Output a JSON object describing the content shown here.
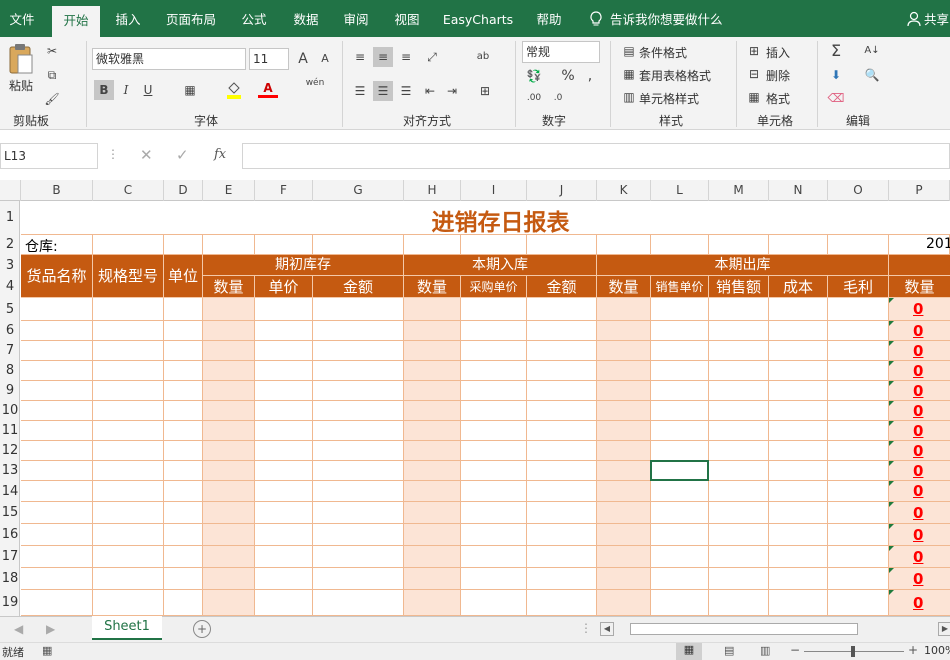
{
  "tabs": [
    "文件",
    "开始",
    "插入",
    "页面布局",
    "公式",
    "数据",
    "审阅",
    "视图",
    "EasyCharts",
    "帮助"
  ],
  "tell_me": "告诉我你想要做什么",
  "share": "共享",
  "clipboard": {
    "paste": "粘贴",
    "group": "剪贴板"
  },
  "font": {
    "name": "微软雅黑",
    "size": "11",
    "group": "字体",
    "bold": "B",
    "italic": "I",
    "underline": "U",
    "font_color_letter": "A",
    "size_up": "A",
    "size_down": "A",
    "phonetic": "wén"
  },
  "alignment": {
    "group": "对齐方式"
  },
  "number": {
    "format": "常规",
    "percent": "%",
    "comma": ",",
    "group": "数字"
  },
  "styles": {
    "conditional": "条件格式",
    "table": "套用表格格式",
    "cell": "单元格样式",
    "group": "样式"
  },
  "cells": {
    "insert": "插入",
    "delete": "删除",
    "format": "格式",
    "group": "单元格"
  },
  "editing": {
    "sum": "Σ",
    "group": "编辑"
  },
  "namebox": "L13",
  "fx": "fx",
  "columns": [
    "B",
    "C",
    "D",
    "E",
    "F",
    "G",
    "H",
    "I",
    "J",
    "K",
    "L",
    "M",
    "N",
    "O",
    "P"
  ],
  "rows": [
    "1",
    "2",
    "3",
    "4",
    "5",
    "6",
    "7",
    "8",
    "9",
    "10",
    "11",
    "12",
    "13",
    "14",
    "15",
    "16",
    "17",
    "18",
    "19"
  ],
  "sheet": {
    "title": "进销存日报表",
    "warehouse_label": "仓库:",
    "date_partial": "201",
    "headers": {
      "name": "货品名称",
      "spec": "规格型号",
      "unit": "单位",
      "opening": "期初库存",
      "purchase": "本期入库",
      "outbound": "本期出库"
    },
    "sub_headers": {
      "opening": [
        "数量",
        "单价",
        "金额"
      ],
      "purchase": [
        "数量",
        "采购单价",
        "金额"
      ],
      "outbound": [
        "数量",
        "销售单价",
        "销售额",
        "成本",
        "毛利"
      ],
      "closing_qty": "数量"
    },
    "p_values": [
      "0",
      "0",
      "0",
      "0",
      "0",
      "0",
      "0",
      "0",
      "0",
      "0",
      "0",
      "0",
      "0",
      "0",
      "0"
    ]
  },
  "sheet_tab": "Sheet1",
  "status": {
    "ready": "就绪",
    "zoom": "100%"
  },
  "colors": {
    "excel_green": "#217346",
    "header_orange": "#c55a11",
    "band": "#fce4d6",
    "grid_line": "#f0b890",
    "title": "#c55a11",
    "zero_red": "#ff0000"
  }
}
